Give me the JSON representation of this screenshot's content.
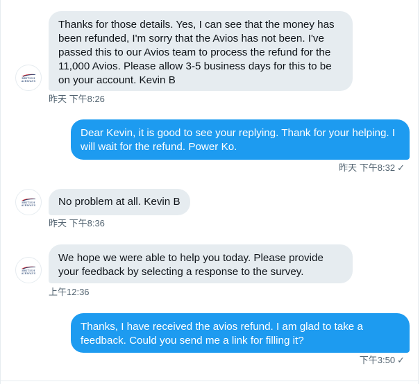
{
  "avatar": {
    "brand_text_line1": "BRITISH",
    "brand_text_line2": "AIRWAYS",
    "icon": "british-airways-logo"
  },
  "messages": [
    {
      "direction": "incoming",
      "text": "Thanks for those details. Yes, I can see that the money has been refunded, I'm sorry that the Avios has not been. I've passed this to our Avios team to process the refund for the 11,000 Avios. Please allow 3-5 business days for this to be on your account. Kevin B",
      "timestamp": "昨天 下午8:26"
    },
    {
      "direction": "outgoing",
      "text": "Dear Kevin, it is good to see your replying. Thank for your helping. I will wait for the refund. Power Ko.",
      "timestamp": "昨天 下午8:32",
      "status_icon": "✓"
    },
    {
      "direction": "incoming",
      "text": "No problem at all. Kevin B",
      "timestamp": "昨天 下午8:36"
    },
    {
      "direction": "incoming",
      "text": "We hope we were able to help you today. Please provide your feedback by selecting a response to the survey.",
      "timestamp": "上午12:36"
    },
    {
      "direction": "outgoing",
      "text": "Thanks, I have received the avios refund. I am glad to take a feedback. Could you send me a link for filling it?",
      "timestamp": "下午3:50",
      "status_icon": "✓"
    }
  ],
  "colors": {
    "incoming_bubble": "#e6ecf0",
    "outgoing_bubble": "#1d9bf0",
    "timestamp": "#536471",
    "ba_navy": "#1b3a6b",
    "ba_red": "#d2232a"
  }
}
